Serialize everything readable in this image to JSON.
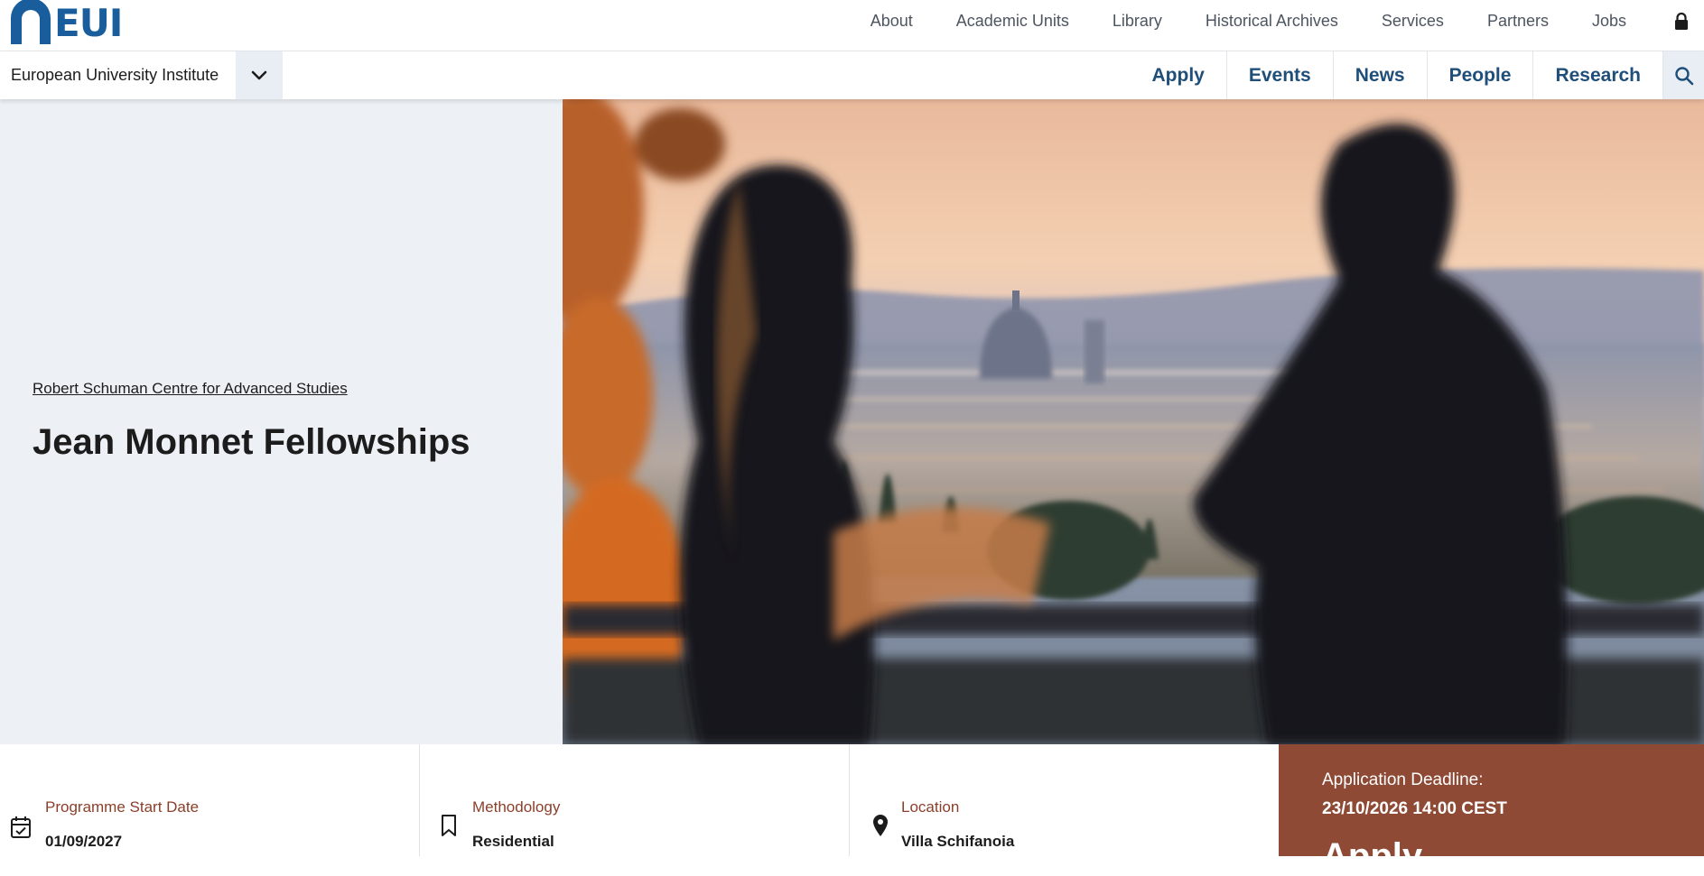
{
  "logo": {
    "text": "EUI",
    "color": "#1a5d9c"
  },
  "utility_nav": {
    "items": [
      {
        "label": "About"
      },
      {
        "label": "Academic Units"
      },
      {
        "label": "Library"
      },
      {
        "label": "Historical Archives"
      },
      {
        "label": "Services"
      },
      {
        "label": "Partners"
      },
      {
        "label": "Jobs"
      }
    ],
    "lock_icon": "lock-icon"
  },
  "institution": {
    "name": "European University Institute",
    "toggle_icon": "chevron-down-icon"
  },
  "main_nav": {
    "items": [
      {
        "label": "Apply"
      },
      {
        "label": "Events"
      },
      {
        "label": "News"
      },
      {
        "label": "People"
      },
      {
        "label": "Research"
      }
    ],
    "search_icon": "search-icon",
    "color": "#1f4e79"
  },
  "hero": {
    "parent_link": "Robert Schuman Centre for Advanced Studies",
    "title": "Jean Monnet Fellowships",
    "background": "#edf1f6",
    "image": "photo-two-people-reading-overlooking-florence"
  },
  "info": {
    "start": {
      "label": "Programme Start Date",
      "value": "01/09/2027",
      "icon": "calendar-check-icon"
    },
    "methodology": {
      "label": "Methodology",
      "value": "Residential",
      "icon": "bookmark-icon"
    },
    "location": {
      "label": "Location",
      "value": "Villa Schifanoia",
      "icon": "map-pin-icon"
    },
    "deadline": {
      "label": "Application Deadline:",
      "value": "23/10/2026 14:00 CEST",
      "cta": "Apply",
      "background": "#8e4a35"
    }
  }
}
